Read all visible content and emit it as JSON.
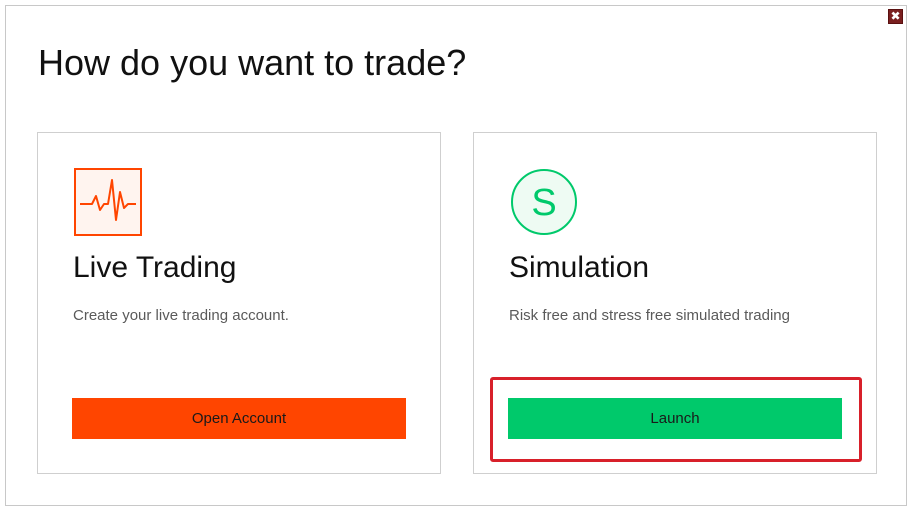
{
  "dialog": {
    "title": "How do you want to trade?",
    "close_icon": "close-icon",
    "close_symbol": "✖"
  },
  "cards": {
    "live": {
      "icon": "heartbeat-chart-icon",
      "icon_color": "#ff4500",
      "title": "Live Trading",
      "description": "Create your live trading account.",
      "button_label": "Open Account",
      "button_color": "#ff4500"
    },
    "simulation": {
      "icon": "simulation-s-icon",
      "icon_letter": "S",
      "icon_color": "#00c96b",
      "title": "Simulation",
      "description": "Risk free and stress free simulated trading",
      "button_label": "Launch",
      "button_color": "#00c96b"
    }
  },
  "annotation": {
    "highlight_color": "#d8202a"
  }
}
